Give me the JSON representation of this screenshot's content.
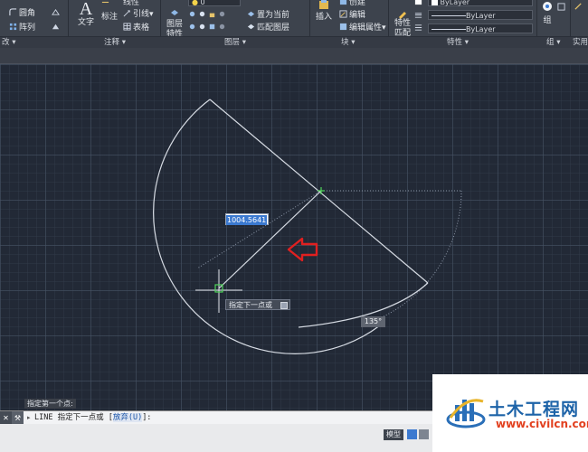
{
  "ribbon": {
    "modify": {
      "fillet": "圆角",
      "array": "阵列"
    },
    "annotation": {
      "text": "文字",
      "dimension": "标注",
      "leader": "引线",
      "table": "表格",
      "linear": "线性"
    },
    "layers": {
      "layer_props": "图层\n特性",
      "set_current": "置为当前",
      "match_layer": "匹配图层",
      "layer_value": "0"
    },
    "block": {
      "insert": "插入",
      "create": "创建",
      "edit": "编辑",
      "edit_attr": "编辑属性"
    },
    "properties": {
      "match": "特性\n匹配",
      "color": "ByLayer",
      "linetype": "ByLayer",
      "lineweight": "ByLayer"
    },
    "groups": {
      "group": "组"
    },
    "panel_labels": {
      "modify": "改",
      "annotation": "注释",
      "layers": "图层",
      "block": "块",
      "properties": "特性",
      "groups": "组",
      "utilities": "实用"
    },
    "dropdown_marker": "▾"
  },
  "canvas": {
    "dynamic_input_value": "1004.5641",
    "tooltip_prompt": "指定下一点或",
    "angle_readout": "135°"
  },
  "command": {
    "history": "指定第一个点:",
    "prompt": "LINE 指定下一点或 [",
    "option": "放弃(U)",
    "prompt_end": "]:"
  },
  "status": {
    "model_tab": "模型"
  },
  "watermark": {
    "title": "土木工程网",
    "url": "www.civilcn.com"
  },
  "colors": {
    "canvas_bg": "#222936",
    "ribbon_bg": "#3d434d",
    "arrow_red": "#e02020",
    "drawing_line": "#d6dbe3",
    "snap_green": "#4fd45a"
  }
}
